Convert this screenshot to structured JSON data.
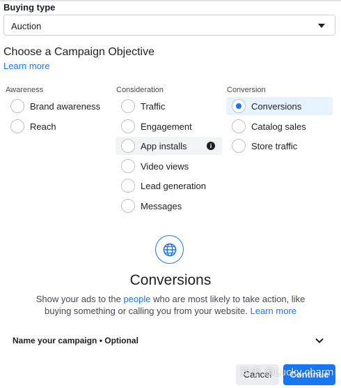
{
  "buying_type": {
    "label": "Buying type",
    "value": "Auction"
  },
  "objective_section": {
    "heading": "Choose a Campaign Objective",
    "learn_more": "Learn more"
  },
  "columns": {
    "awareness": {
      "label": "Awareness",
      "options": [
        "Brand awareness",
        "Reach"
      ]
    },
    "consideration": {
      "label": "Consideration",
      "options": [
        "Traffic",
        "Engagement",
        "App installs",
        "Video views",
        "Lead generation",
        "Messages"
      ]
    },
    "conversion": {
      "label": "Conversion",
      "options": [
        "Conversions",
        "Catalog sales",
        "Store traffic"
      ]
    }
  },
  "selected_objective": "Conversions",
  "detail": {
    "title": "Conversions",
    "desc_part1": "Show your ads to the ",
    "desc_link_people": "people",
    "desc_part2": " who are most likely to take action, like buying something or calling you from your website. ",
    "desc_learn_more": "Learn more"
  },
  "name_campaign": {
    "label": "Name your campaign • Optional"
  },
  "footer": {
    "cancel_label": "Cancel",
    "continue_label": "Continue"
  },
  "watermark": "知乎 @Lucky charm",
  "colors": {
    "accent": "#1877f2",
    "selected_bg": "#e7f3ff"
  }
}
